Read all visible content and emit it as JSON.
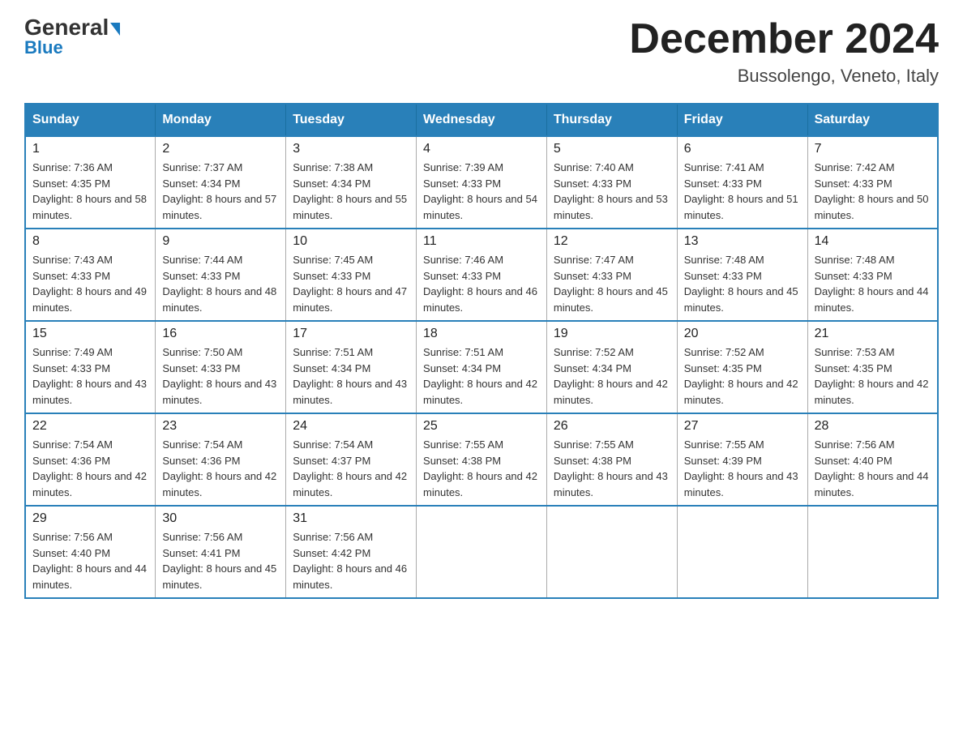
{
  "header": {
    "logo_general": "General",
    "logo_blue": "Blue",
    "title": "December 2024",
    "subtitle": "Bussolengo, Veneto, Italy"
  },
  "weekdays": [
    "Sunday",
    "Monday",
    "Tuesday",
    "Wednesday",
    "Thursday",
    "Friday",
    "Saturday"
  ],
  "weeks": [
    [
      {
        "day": "1",
        "sunrise": "7:36 AM",
        "sunset": "4:35 PM",
        "daylight": "8 hours and 58 minutes."
      },
      {
        "day": "2",
        "sunrise": "7:37 AM",
        "sunset": "4:34 PM",
        "daylight": "8 hours and 57 minutes."
      },
      {
        "day": "3",
        "sunrise": "7:38 AM",
        "sunset": "4:34 PM",
        "daylight": "8 hours and 55 minutes."
      },
      {
        "day": "4",
        "sunrise": "7:39 AM",
        "sunset": "4:33 PM",
        "daylight": "8 hours and 54 minutes."
      },
      {
        "day": "5",
        "sunrise": "7:40 AM",
        "sunset": "4:33 PM",
        "daylight": "8 hours and 53 minutes."
      },
      {
        "day": "6",
        "sunrise": "7:41 AM",
        "sunset": "4:33 PM",
        "daylight": "8 hours and 51 minutes."
      },
      {
        "day": "7",
        "sunrise": "7:42 AM",
        "sunset": "4:33 PM",
        "daylight": "8 hours and 50 minutes."
      }
    ],
    [
      {
        "day": "8",
        "sunrise": "7:43 AM",
        "sunset": "4:33 PM",
        "daylight": "8 hours and 49 minutes."
      },
      {
        "day": "9",
        "sunrise": "7:44 AM",
        "sunset": "4:33 PM",
        "daylight": "8 hours and 48 minutes."
      },
      {
        "day": "10",
        "sunrise": "7:45 AM",
        "sunset": "4:33 PM",
        "daylight": "8 hours and 47 minutes."
      },
      {
        "day": "11",
        "sunrise": "7:46 AM",
        "sunset": "4:33 PM",
        "daylight": "8 hours and 46 minutes."
      },
      {
        "day": "12",
        "sunrise": "7:47 AM",
        "sunset": "4:33 PM",
        "daylight": "8 hours and 45 minutes."
      },
      {
        "day": "13",
        "sunrise": "7:48 AM",
        "sunset": "4:33 PM",
        "daylight": "8 hours and 45 minutes."
      },
      {
        "day": "14",
        "sunrise": "7:48 AM",
        "sunset": "4:33 PM",
        "daylight": "8 hours and 44 minutes."
      }
    ],
    [
      {
        "day": "15",
        "sunrise": "7:49 AM",
        "sunset": "4:33 PM",
        "daylight": "8 hours and 43 minutes."
      },
      {
        "day": "16",
        "sunrise": "7:50 AM",
        "sunset": "4:33 PM",
        "daylight": "8 hours and 43 minutes."
      },
      {
        "day": "17",
        "sunrise": "7:51 AM",
        "sunset": "4:34 PM",
        "daylight": "8 hours and 43 minutes."
      },
      {
        "day": "18",
        "sunrise": "7:51 AM",
        "sunset": "4:34 PM",
        "daylight": "8 hours and 42 minutes."
      },
      {
        "day": "19",
        "sunrise": "7:52 AM",
        "sunset": "4:34 PM",
        "daylight": "8 hours and 42 minutes."
      },
      {
        "day": "20",
        "sunrise": "7:52 AM",
        "sunset": "4:35 PM",
        "daylight": "8 hours and 42 minutes."
      },
      {
        "day": "21",
        "sunrise": "7:53 AM",
        "sunset": "4:35 PM",
        "daylight": "8 hours and 42 minutes."
      }
    ],
    [
      {
        "day": "22",
        "sunrise": "7:54 AM",
        "sunset": "4:36 PM",
        "daylight": "8 hours and 42 minutes."
      },
      {
        "day": "23",
        "sunrise": "7:54 AM",
        "sunset": "4:36 PM",
        "daylight": "8 hours and 42 minutes."
      },
      {
        "day": "24",
        "sunrise": "7:54 AM",
        "sunset": "4:37 PM",
        "daylight": "8 hours and 42 minutes."
      },
      {
        "day": "25",
        "sunrise": "7:55 AM",
        "sunset": "4:38 PM",
        "daylight": "8 hours and 42 minutes."
      },
      {
        "day": "26",
        "sunrise": "7:55 AM",
        "sunset": "4:38 PM",
        "daylight": "8 hours and 43 minutes."
      },
      {
        "day": "27",
        "sunrise": "7:55 AM",
        "sunset": "4:39 PM",
        "daylight": "8 hours and 43 minutes."
      },
      {
        "day": "28",
        "sunrise": "7:56 AM",
        "sunset": "4:40 PM",
        "daylight": "8 hours and 44 minutes."
      }
    ],
    [
      {
        "day": "29",
        "sunrise": "7:56 AM",
        "sunset": "4:40 PM",
        "daylight": "8 hours and 44 minutes."
      },
      {
        "day": "30",
        "sunrise": "7:56 AM",
        "sunset": "4:41 PM",
        "daylight": "8 hours and 45 minutes."
      },
      {
        "day": "31",
        "sunrise": "7:56 AM",
        "sunset": "4:42 PM",
        "daylight": "8 hours and 46 minutes."
      },
      null,
      null,
      null,
      null
    ]
  ]
}
